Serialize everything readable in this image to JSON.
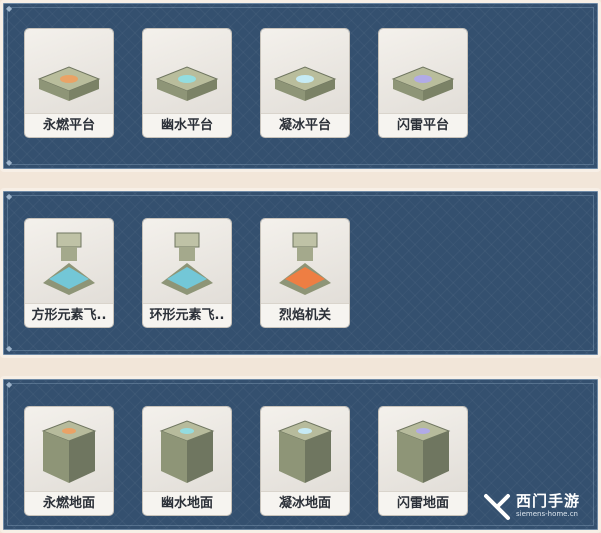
{
  "platforms": [
    {
      "label": "永燃平台",
      "icon": "platform-fire-icon",
      "glow": "#f0a060"
    },
    {
      "label": "幽水平台",
      "icon": "platform-water-icon",
      "glow": "#8fe0e8"
    },
    {
      "label": "凝冰平台",
      "icon": "platform-ice-icon",
      "glow": "#c8f0ff"
    },
    {
      "label": "闪雷平台",
      "icon": "platform-thunder-icon",
      "glow": "#b0a8f0"
    }
  ],
  "mechanisms": [
    {
      "label": "方形元素飞..",
      "icon": "square-element-tower-icon",
      "glow": "#6fd0e8"
    },
    {
      "label": "环形元素飞..",
      "icon": "ring-element-tower-icon",
      "glow": "#6fd0e8"
    },
    {
      "label": "烈焰机关",
      "icon": "flame-mechanism-icon",
      "glow": "#ff7a3a"
    }
  ],
  "grounds": [
    {
      "label": "永燃地面",
      "icon": "ground-fire-icon",
      "glow": "#f0a060"
    },
    {
      "label": "幽水地面",
      "icon": "ground-water-icon",
      "glow": "#8fe0e8"
    },
    {
      "label": "凝冰地面",
      "icon": "ground-ice-icon",
      "glow": "#c8f0ff"
    },
    {
      "label": "闪雷地面",
      "icon": "ground-thunder-icon",
      "glow": "#b0a8f0"
    }
  ],
  "watermark": {
    "title": "西门手游",
    "subtitle": "siemens-home.cn"
  },
  "colors": {
    "panel": "#34506f",
    "border": "#f7efe6",
    "card": "#f4f1ec"
  }
}
